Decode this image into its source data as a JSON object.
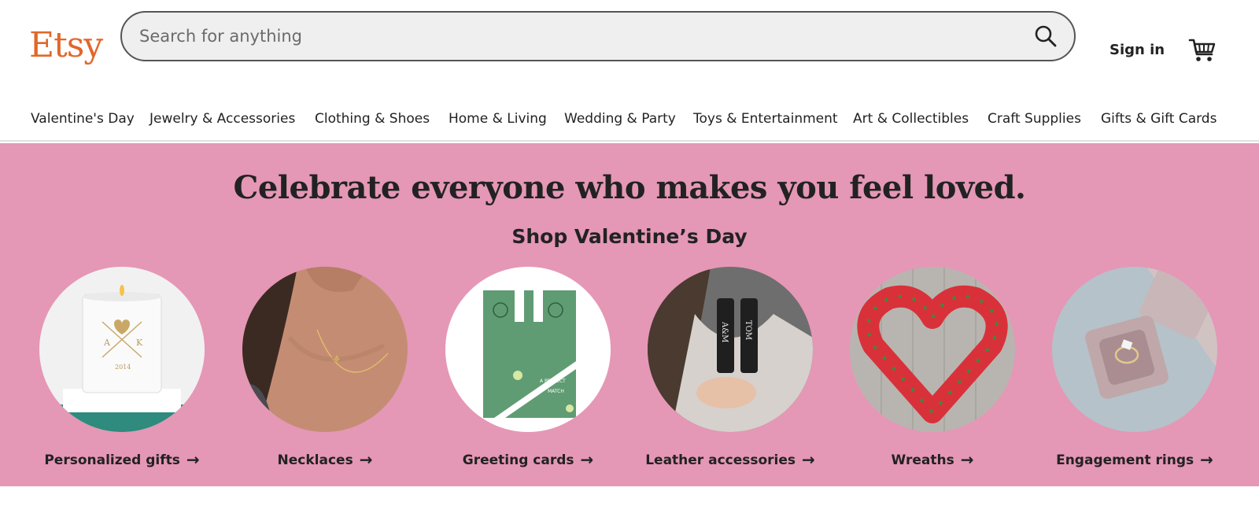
{
  "header": {
    "logo_text": "Etsy",
    "search_placeholder": "Search for anything",
    "search_icon": "search-icon",
    "signin_label": "Sign in",
    "cart_icon": "cart-icon",
    "colors": {
      "brand": "#e2672a",
      "search_bg": "#efefef"
    }
  },
  "nav": {
    "categories": [
      "Valentine's Day",
      "Jewelry & Accessories",
      "Clothing & Shoes",
      "Home & Living",
      "Wedding & Party",
      "Toys & Entertainment",
      "Art & Collectibles",
      "Craft Supplies",
      "Gifts & Gift Cards"
    ]
  },
  "hero": {
    "title": "Celebrate everyone who makes you feel loved.",
    "subtitle": "Shop Valentine’s Day",
    "background": "#e597b6",
    "arrow_icon": "arrow-right-icon",
    "cards": [
      {
        "label": "Personalized gifts",
        "image": "personalized-candle-image",
        "candle_text": [
          "A",
          "K",
          "2014"
        ]
      },
      {
        "label": "Necklaces",
        "image": "necklace-image"
      },
      {
        "label": "Greeting cards",
        "image": "greeting-card-image",
        "card_text": [
          "A PERFECT",
          "MATCH"
        ]
      },
      {
        "label": "Leather accessories",
        "image": "leather-keychain-image",
        "keychain_text": [
          "A&M",
          "TOM"
        ]
      },
      {
        "label": "Wreaths",
        "image": "tulip-wreath-image"
      },
      {
        "label": "Engagement rings",
        "image": "ring-box-image"
      }
    ]
  }
}
